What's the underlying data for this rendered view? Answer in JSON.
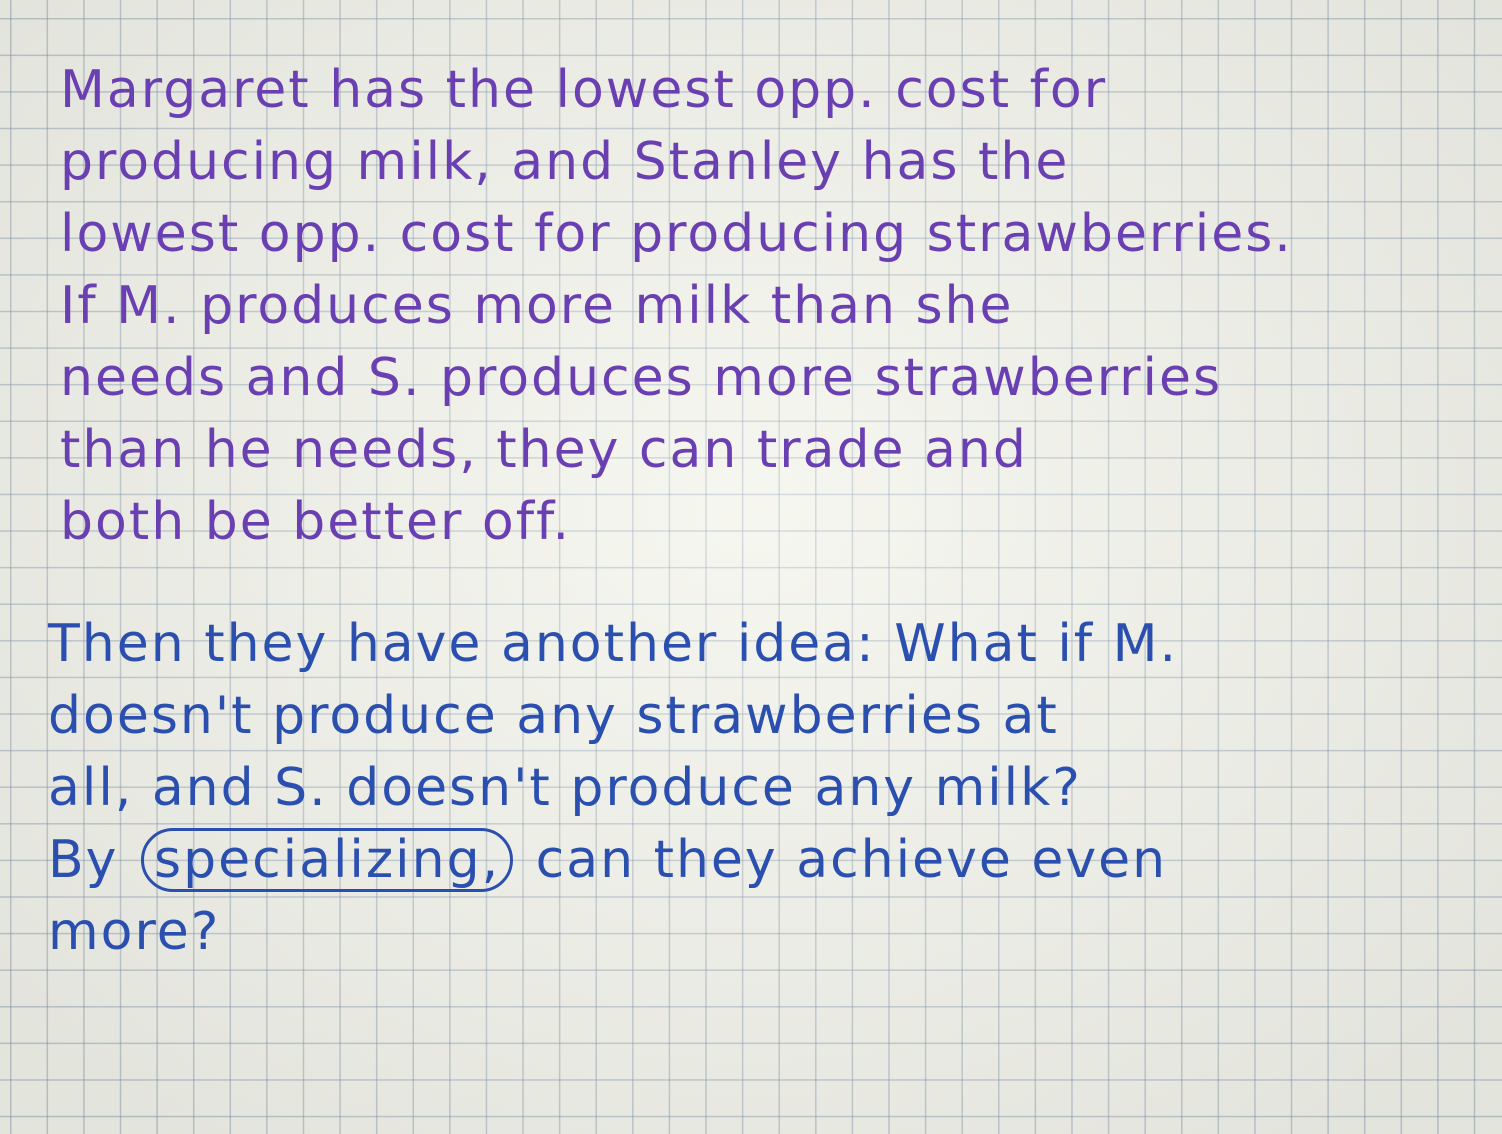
{
  "colors": {
    "ink_purple": "#6a3fb2",
    "ink_blue": "#2b4fae",
    "paper": "#f1f2ea",
    "grid": "#8c9fb6"
  },
  "note": {
    "paragraph_1": {
      "ink": "purple",
      "lines": [
        "Margaret has the lowest opp. cost for",
        "producing milk, and Stanley has the",
        "lowest opp. cost for producing strawberries.",
        "If M. produces more milk than she",
        "needs and S. produces more strawberries",
        "than he needs, they can trade and",
        "both be better off."
      ]
    },
    "paragraph_2": {
      "ink": "blue",
      "lines": [
        "Then they have another idea: What if M.",
        "doesn't produce any strawberries at",
        "all, and S. doesn't produce any milk?"
      ],
      "line_4": {
        "before": "By",
        "circled_word": "specializing,",
        "after": "can they achieve even"
      },
      "line_5": "more?"
    }
  }
}
